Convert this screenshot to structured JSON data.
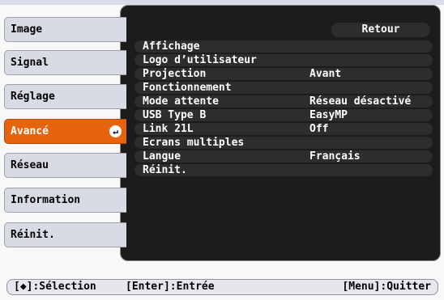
{
  "tabs": [
    {
      "label": "Image",
      "active": false
    },
    {
      "label": "Signal",
      "active": false
    },
    {
      "label": "Réglage",
      "active": false
    },
    {
      "label": "Avancé",
      "active": true
    },
    {
      "label": "Réseau",
      "active": false
    },
    {
      "label": "Information",
      "active": false
    },
    {
      "label": "Réinit.",
      "active": false
    }
  ],
  "panel": {
    "back_label": "Retour",
    "rows": [
      {
        "label": "Affichage",
        "value": ""
      },
      {
        "label": "Logo d’utilisateur",
        "value": ""
      },
      {
        "label": "Projection",
        "value": "Avant"
      },
      {
        "label": "Fonctionnement",
        "value": ""
      },
      {
        "label": "Mode attente",
        "value": "Réseau désactivé"
      },
      {
        "label": "USB Type B",
        "value": "EasyMP"
      },
      {
        "label": "Link 21L",
        "value": "Off"
      },
      {
        "label": "Ecrans multiples",
        "value": ""
      },
      {
        "label": "Langue",
        "value": "Français"
      },
      {
        "label": "Réinit.",
        "value": ""
      }
    ]
  },
  "footer": {
    "left": "[◆]:Sélection",
    "middle": "[Enter]:Entrée",
    "right": "[Menu]:Quitter"
  },
  "colors": {
    "active_tab": "#e7640e",
    "panel": "#1c1c1c"
  }
}
